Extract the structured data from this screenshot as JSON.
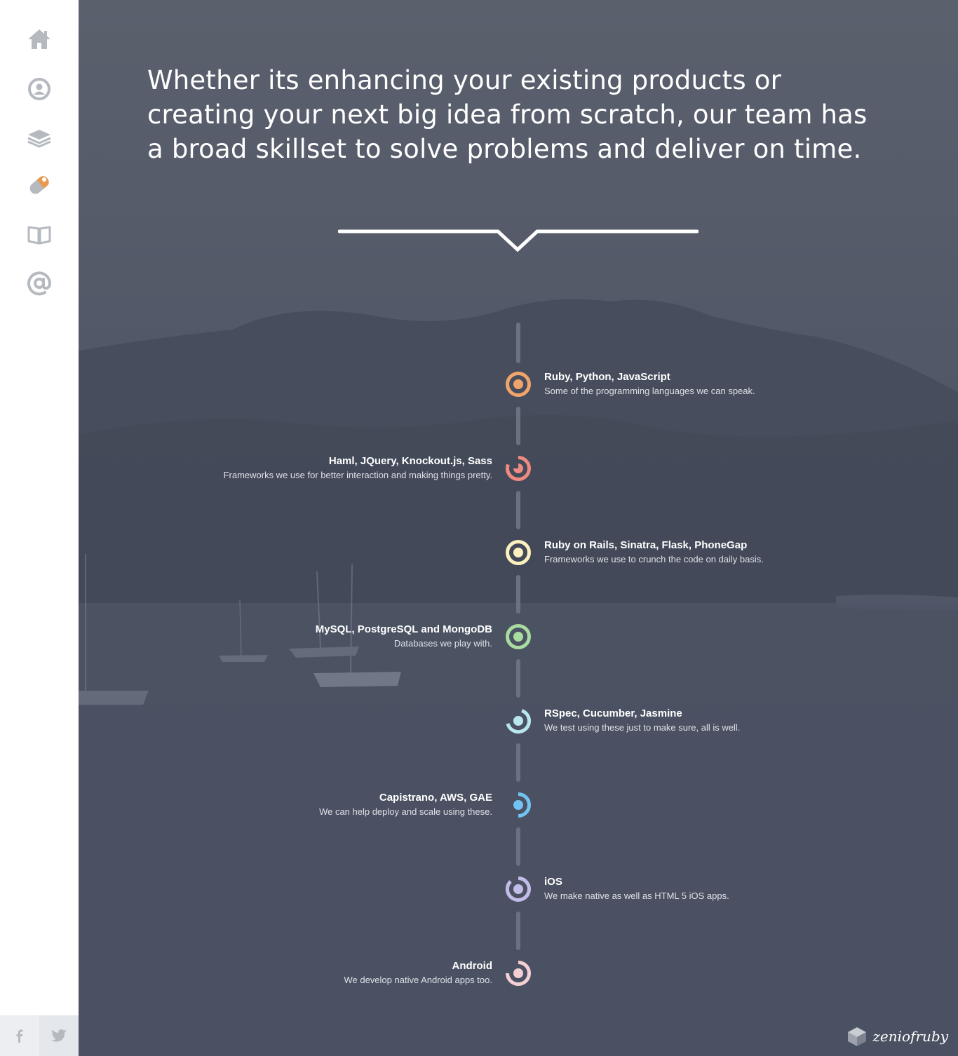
{
  "sidebar": {
    "nav": [
      {
        "name": "home-icon",
        "label": "Home"
      },
      {
        "name": "user-icon",
        "label": "About"
      },
      {
        "name": "layers-icon",
        "label": "Services"
      },
      {
        "name": "pill-icon",
        "label": "Work"
      },
      {
        "name": "book-icon",
        "label": "Blog"
      },
      {
        "name": "at-icon",
        "label": "Contact"
      }
    ],
    "social": [
      {
        "name": "facebook-icon",
        "glyph": "f"
      },
      {
        "name": "twitter-icon",
        "glyph": "twitter"
      }
    ],
    "icon_color": "#b5b9c0"
  },
  "main": {
    "headline": "Whether its enhancing your existing products or creating your next big idea from scratch, our team has a broad skillset to solve problems and deliver on time."
  },
  "timeline": {
    "items": [
      {
        "title": "Ruby, Python, JavaScript",
        "desc": "Some of the programming languages we can speak.",
        "side": "right",
        "color": "#f0a46b",
        "icon": "target-icon"
      },
      {
        "title": "Haml, JQuery, Knockout.js, Sass",
        "desc": "Frameworks we use for better interaction and making things pretty.",
        "side": "left",
        "color": "#ee8a80",
        "icon": "partial-ring-icon"
      },
      {
        "title": "Ruby on Rails, Sinatra, Flask, PhoneGap",
        "desc": "Frameworks we use to crunch the code on daily basis.",
        "side": "right",
        "color": "#fbf0be",
        "icon": "target-icon"
      },
      {
        "title": "MySQL, PostgreSQL and MongoDB",
        "desc": "Databases we play with.",
        "side": "left",
        "color": "#a8dca0",
        "icon": "target-icon"
      },
      {
        "title": "RSpec, Cucumber, Jasmine",
        "desc": "We test using these just to make sure, all is well.",
        "side": "right",
        "color": "#b7e6ef",
        "icon": "partial-ring-icon"
      },
      {
        "title": "Capistrano, AWS, GAE",
        "desc": "We can help deploy and scale using these.",
        "side": "left",
        "color": "#72c3f2",
        "icon": "half-ring-icon"
      },
      {
        "title": "iOS",
        "desc": "We make native as well as HTML 5 iOS apps.",
        "side": "right",
        "color": "#c2bde8",
        "icon": "partial-ring-icon"
      },
      {
        "title": "Android",
        "desc": "We develop native Android apps too.",
        "side": "left",
        "color": "#f5cfd6",
        "icon": "partial-ring-icon"
      }
    ]
  },
  "brand": {
    "name": "zeniofruby",
    "logo_icon": "cube-logo-icon"
  }
}
